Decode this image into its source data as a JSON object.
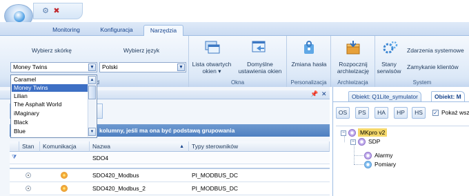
{
  "tabs": [
    {
      "label": "Monitoring",
      "active": false
    },
    {
      "label": "Konfiguracja",
      "active": false
    },
    {
      "label": "Narzędzia",
      "active": true
    }
  ],
  "ribbon": {
    "skin_label": "Wybierz skórkę",
    "skin_value": "Money Twins",
    "lang_label": "Wybierz język",
    "lang_value": "Polski",
    "group1_caption": "giąd",
    "open_windows_label": "Lista otwartych okien ▾",
    "default_windows_label": "Domyślne ustawienia okien",
    "group2_caption": "Okna",
    "change_password_label": "Zmiana hasła",
    "group3_caption": "Personalizacja",
    "archiving_label": "Rozpocznij archiwizację",
    "group4_caption": "Archiwizacja",
    "service_states_label": "Stany serwisów",
    "system_events_label": "Zdarzenia systemowe",
    "close_clients_label": "Zamykanie klientów",
    "group5_caption": "System"
  },
  "skin_dropdown": {
    "items": [
      "Caramel",
      "Money Twins",
      "Lilian",
      "The Asphalt World",
      "iMaginary",
      "Black",
      "Blue"
    ],
    "selected": "Money Twins"
  },
  "left_pane": {
    "pin_glyph": "📌",
    "close_glyph": "✕",
    "group_banner": "kolumny, jeśli ma ona być podstawą grupowania",
    "columns": [
      "Stan",
      "Komunikacja",
      "Nazwa",
      "Typy sterowników"
    ],
    "filter_row": {
      "nazwa": "SDO4"
    },
    "rows": [
      {
        "nazwa": "SDO420_Modbus",
        "typ": "PI_MODBUS_DC"
      },
      {
        "nazwa": "SDO420_Modbus_2",
        "typ": "PI_MODBUS_DC"
      }
    ]
  },
  "right_pane": {
    "tabs": [
      {
        "label": "Obiekt: Q1Lite_symulator",
        "active": false
      },
      {
        "label": "Obiekt: M",
        "active": true
      }
    ],
    "toolbar": [
      "OS",
      "PS",
      "HA",
      "HP",
      "HS"
    ],
    "show_all_label": "Pokaż wsz",
    "show_all_checked": true,
    "tree": [
      {
        "label": "MKpro v2",
        "highlighted": true
      },
      {
        "label": "SDP",
        "highlighted": false
      },
      {
        "label": "Alarmy",
        "highlighted": false
      },
      {
        "label": "Pomiary",
        "highlighted": false
      }
    ]
  }
}
